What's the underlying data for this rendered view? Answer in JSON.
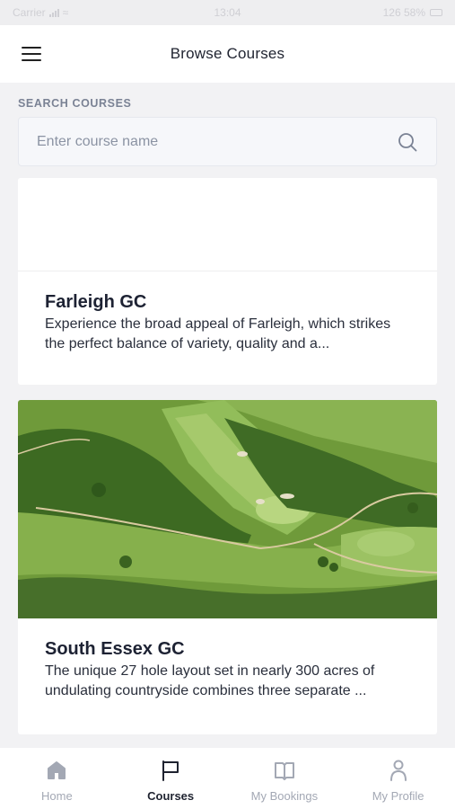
{
  "status_bar": {
    "carrier": "Carrier",
    "time": "13:04",
    "battery": "126 58%"
  },
  "header": {
    "title": "Browse Courses",
    "menu_icon": "hamburger-menu-icon"
  },
  "search": {
    "label": "SEARCH COURSES",
    "placeholder": "Enter course name",
    "value": "",
    "icon": "search-icon"
  },
  "courses": [
    {
      "title": "Farleigh GC",
      "description": "Experience the broad appeal of Farleigh, which strikes the perfect balance of variety, quality and a...",
      "has_image": false
    },
    {
      "title": "South Essex GC",
      "description": "The unique 27 hole layout set in nearly 300 acres of undulating countryside combines three separate ...",
      "has_image": true
    }
  ],
  "tabs": [
    {
      "label": "Home",
      "icon": "home-icon",
      "active": false
    },
    {
      "label": "Courses",
      "icon": "flag-icon",
      "active": true
    },
    {
      "label": "My Bookings",
      "icon": "book-icon",
      "active": false
    },
    {
      "label": "My Profile",
      "icon": "person-icon",
      "active": false
    }
  ],
  "colors": {
    "active_tab": "#1f2330",
    "inactive_tab": "#a3a8b4",
    "background": "#f2f2f4"
  }
}
